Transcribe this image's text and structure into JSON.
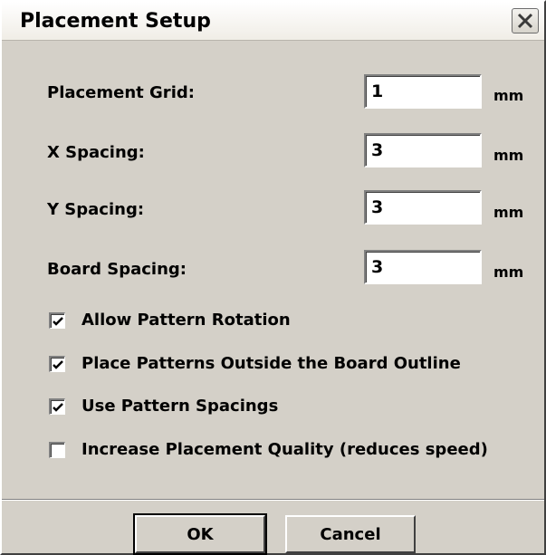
{
  "window": {
    "title": "Placement Setup",
    "close_icon": "close-icon"
  },
  "fields": [
    {
      "label": "Placement Grid:",
      "value": "1",
      "unit": "mm"
    },
    {
      "label": "X Spacing:",
      "value": "3",
      "unit": "mm"
    },
    {
      "label": "Y Spacing:",
      "value": "3",
      "unit": "mm"
    },
    {
      "label": "Board Spacing:",
      "value": "3",
      "unit": "mm"
    }
  ],
  "options": [
    {
      "label": "Allow Pattern Rotation",
      "checked": true
    },
    {
      "label": "Place Patterns Outside the Board Outline",
      "checked": true
    },
    {
      "label": "Use Pattern Spacings",
      "checked": true
    },
    {
      "label": "Increase Placement Quality (reduces speed)",
      "checked": false
    }
  ],
  "buttons": {
    "ok": "OK",
    "cancel": "Cancel"
  }
}
